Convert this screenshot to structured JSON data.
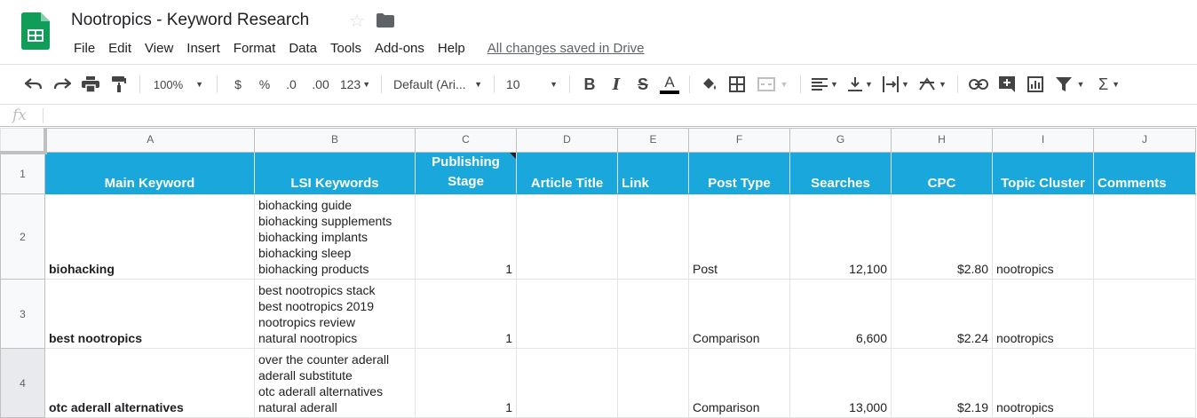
{
  "app": {
    "doc_title": "Nootropics - Keyword Research",
    "icons": {
      "logo": "sheets-logo-icon",
      "star": "star-icon",
      "folder": "folder-icon"
    },
    "brand_color": "#0f9d58"
  },
  "menu": {
    "items": [
      "File",
      "Edit",
      "View",
      "Insert",
      "Format",
      "Data",
      "Tools",
      "Add-ons",
      "Help"
    ],
    "saved_status": "All changes saved in Drive"
  },
  "toolbar": {
    "zoom": "100%",
    "currency": "$",
    "percent": "%",
    "decrease_decimal": ".0",
    "increase_decimal": ".00",
    "more_formats": "123",
    "font": "Default (Ari...",
    "font_size": "10",
    "bold": "B",
    "italic": "I",
    "strike": "S",
    "text_color_letter": "A"
  },
  "formula_bar": {
    "label": "fx",
    "value": ""
  },
  "grid": {
    "columns": [
      "A",
      "B",
      "C",
      "D",
      "E",
      "F",
      "G",
      "H",
      "I",
      "J"
    ],
    "header_row": {
      "row_number": "1",
      "bg_color": "#1aa7dc",
      "cells": [
        "Main Keyword",
        "LSI Keywords",
        "Publishing Stage",
        "Article Title",
        "Link",
        "Post Type",
        "Searches",
        "CPC",
        "Topic Cluster",
        "Comments"
      ],
      "publishing_stage_line1": "Publishing",
      "publishing_stage_line2": "Stage"
    },
    "rows": [
      {
        "row_number": "2",
        "main_keyword": "biohacking",
        "lsi_keywords": [
          "biohacking guide",
          "biohacking supplements",
          "biohacking implants",
          "biohacking sleep",
          "biohacking products"
        ],
        "publishing_stage": "1",
        "article_title": "",
        "link": "",
        "post_type": "Post",
        "searches": "12,100",
        "cpc": "$2.80",
        "topic_cluster": "nootropics",
        "comments": ""
      },
      {
        "row_number": "3",
        "main_keyword": "best nootropics",
        "lsi_keywords": [
          "best nootropics stack",
          "best nootropics 2019",
          "nootropics review",
          "natural nootropics"
        ],
        "publishing_stage": "1",
        "article_title": "",
        "link": "",
        "post_type": "Comparison",
        "searches": "6,600",
        "cpc": "$2.24",
        "topic_cluster": "nootropics",
        "comments": ""
      },
      {
        "row_number": "4",
        "main_keyword": "otc aderall alternatives",
        "lsi_keywords": [
          "over the counter aderall",
          "aderall substitute",
          "otc aderall alternatives",
          "natural aderall"
        ],
        "publishing_stage": "1",
        "article_title": "",
        "link": "",
        "post_type": "Comparison",
        "searches": "13,000",
        "cpc": "$2.19",
        "topic_cluster": "nootropics",
        "comments": ""
      }
    ]
  }
}
